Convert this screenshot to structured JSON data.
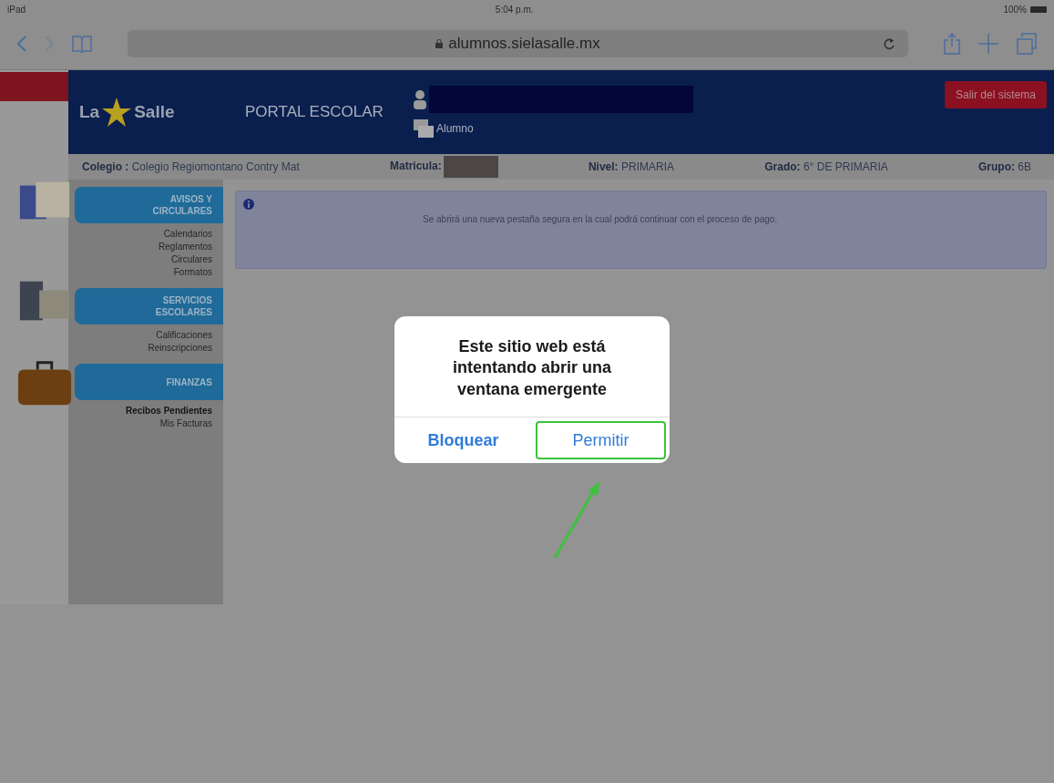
{
  "status_bar": {
    "device": "iPad",
    "time": "5:04 p.m.",
    "battery": "100%"
  },
  "browser": {
    "url": "alumnos.sielasalle.mx"
  },
  "header": {
    "logo_left": "La",
    "logo_right": "Salle",
    "title": "PORTAL ESCOLAR",
    "role": "Alumno",
    "logout": "Salir del sistema"
  },
  "info_bar": [
    {
      "kind": "text",
      "label": "Colegio :",
      "value": "Colegio Regiomontano Contry Mat"
    },
    {
      "kind": "redacted",
      "label": "Matricula:"
    },
    {
      "kind": "text",
      "label": "Nivel:",
      "value": "PRIMARIA"
    },
    {
      "kind": "text",
      "label": "Grado:",
      "value": "6° DE PRIMARIA"
    },
    {
      "kind": "text",
      "label": "Grupo:",
      "value": "6B"
    }
  ],
  "sidebar": {
    "sections": [
      {
        "kind": "notices",
        "title": "AVISOS Y CIRCULARES",
        "items": [
          {
            "label": "Calendarios",
            "selected": false
          },
          {
            "label": "Reglamentos",
            "selected": false
          },
          {
            "label": "Circulares",
            "selected": false
          },
          {
            "label": "Formatos",
            "selected": false
          }
        ]
      },
      {
        "kind": "services",
        "title": "SERVICIOS ESCOLARES",
        "items": [
          {
            "label": "Calificaciones",
            "selected": false
          },
          {
            "label": "Reinscripciones",
            "selected": false
          }
        ]
      },
      {
        "kind": "finance",
        "title": "FINANZAS",
        "items": [
          {
            "label": "Recibos Pendientes",
            "selected": true
          },
          {
            "label": "Mis Facturas",
            "selected": false
          }
        ]
      }
    ]
  },
  "notice": {
    "text": "Se abrirá una nueva pestaña segura en la cual podrá continuar con el proceso de pago."
  },
  "dialog": {
    "message": "Este sitio web está intentando abrir una ventana emergente",
    "buttons": [
      {
        "label": "Bloquear",
        "highlighted": false
      },
      {
        "label": "Permitir",
        "highlighted": true
      }
    ]
  }
}
